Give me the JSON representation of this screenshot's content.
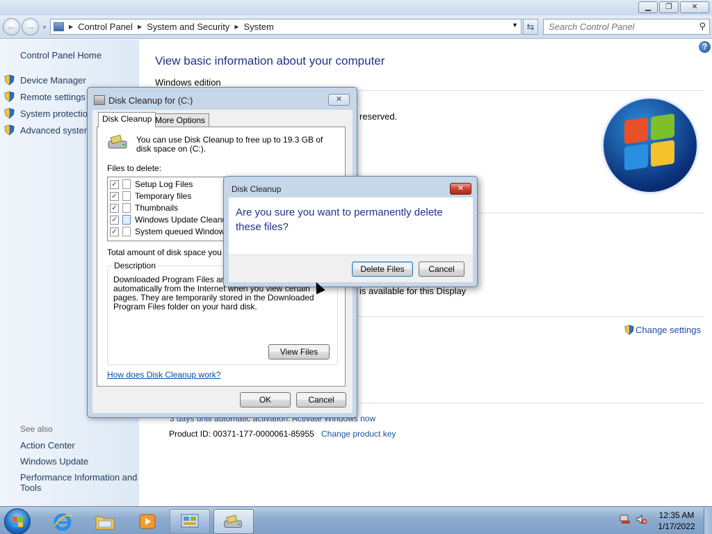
{
  "window": {
    "minimize_glyph": "▁",
    "restore_glyph": "❐",
    "close_glyph": "✕"
  },
  "nav": {
    "back_glyph": "←",
    "forward_glyph": "→",
    "breadcrumb": [
      "Control Panel",
      "System and Security",
      "System"
    ],
    "refresh_glyph": "⇆",
    "search_placeholder": "Search Control Panel"
  },
  "sidebar": {
    "home": "Control Panel Home",
    "tasks": [
      "Device Manager",
      "Remote settings",
      "System protection",
      "Advanced system"
    ],
    "see_also_heading": "See also",
    "see_also": [
      "Action Center",
      "Windows Update",
      "Performance Information and",
      "Tools"
    ]
  },
  "main": {
    "title": "View basic information about your computer",
    "windows_edition": "Windows edition",
    "reserved": "reserved.",
    "display_text": "is available for this Display",
    "change_settings": "Change settings",
    "activation": "3 days until automatic activation. Activate Windows now",
    "product_id": "Product ID: 00371-177-0000061-85955",
    "change_key": "Change product key"
  },
  "disk_cleanup": {
    "title": "Disk Cleanup for  (C:)",
    "close_glyph": "✕",
    "tabs": [
      "Disk Cleanup",
      "More Options"
    ],
    "intro": "You can use Disk Cleanup to free up to 19.3 GB of disk space on  (C:).",
    "files_label": "Files to delete:",
    "files": [
      {
        "name": "Setup Log Files",
        "checked": true
      },
      {
        "name": "Temporary files",
        "checked": true
      },
      {
        "name": "Thumbnails",
        "checked": true
      },
      {
        "name": "Windows Update Cleanup",
        "checked": true
      },
      {
        "name": "System queued Windows E",
        "checked": true
      }
    ],
    "total_label": "Total amount of disk space you gai",
    "description_label": "Description",
    "description": "Downloaded Program Files are Ac downloaded automatically from the Internet when you view certain pages. They are temporarily stored in the Downloaded Program Files folder on your hard disk.",
    "view_files": "View Files",
    "how_link": "How does Disk Cleanup work?",
    "ok": "OK",
    "cancel": "Cancel"
  },
  "confirm": {
    "title": "Disk Cleanup",
    "close_glyph": "✕",
    "message": "Are you sure you want to permanently delete these files?",
    "delete": "Delete Files",
    "cancel": "Cancel"
  },
  "taskbar": {
    "time": "12:35 AM",
    "date": "1/17/2022"
  },
  "colors": {
    "link": "#1e4fa0",
    "heading": "#1e3287",
    "taskbar": "#8fadd0"
  }
}
